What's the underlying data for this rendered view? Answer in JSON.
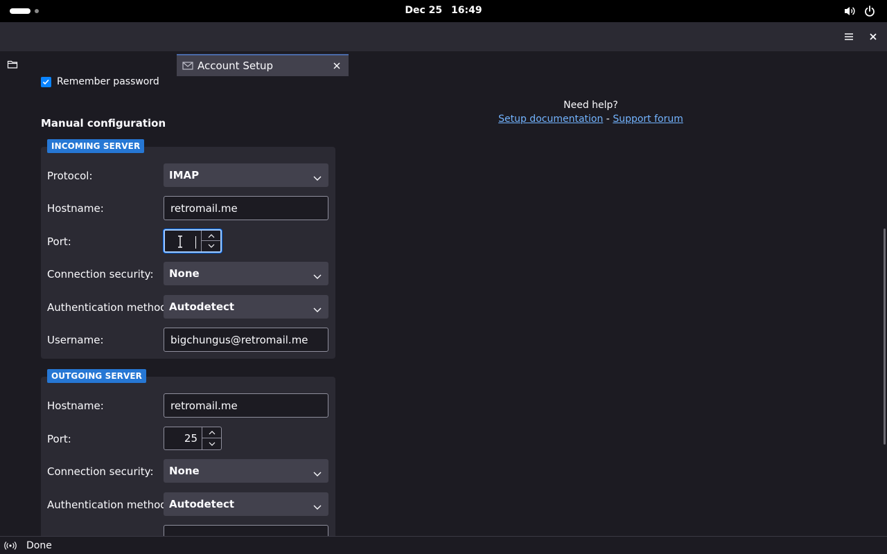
{
  "topbar": {
    "date": "Dec 25",
    "time": "16:49",
    "icons": [
      "activities-indicator",
      "volume-icon",
      "power-icon"
    ]
  },
  "titlebar": {
    "icons": [
      "menu-icon",
      "close-icon"
    ]
  },
  "tabs": [
    {
      "label": "Account Setup",
      "icon": "mail-icon",
      "active": true
    }
  ],
  "form": {
    "remember_password": {
      "label": "Remember password",
      "checked": true
    },
    "section_title": "Manual configuration",
    "incoming": {
      "tag": "INCOMING SERVER",
      "protocol": {
        "label": "Protocol:",
        "value": "IMAP"
      },
      "hostname": {
        "label": "Hostname:",
        "value": "retromail.me"
      },
      "port": {
        "label": "Port:",
        "value": ""
      },
      "security": {
        "label": "Connection security:",
        "value": "None"
      },
      "auth": {
        "label": "Authentication method:",
        "value": "Autodetect"
      },
      "username": {
        "label": "Username:",
        "value": "bigchungus@retromail.me"
      }
    },
    "outgoing": {
      "tag": "OUTGOING SERVER",
      "hostname": {
        "label": "Hostname:",
        "value": "retromail.me"
      },
      "port": {
        "label": "Port:",
        "value": "25"
      },
      "security": {
        "label": "Connection security:",
        "value": "None"
      },
      "auth": {
        "label": "Authentication method:",
        "value": "Autodetect"
      }
    }
  },
  "help": {
    "title": "Need help?",
    "doc_link": "Setup documentation",
    "separator": "-",
    "forum_link": "Support forum"
  },
  "status": {
    "text": "Done",
    "icon": "connection-icon"
  },
  "colors": {
    "accent": "#0a84ff",
    "tag_bg": "#2677d4",
    "link": "#73b4ff",
    "background": "#1c1b22",
    "panel": "#2b2a33"
  }
}
